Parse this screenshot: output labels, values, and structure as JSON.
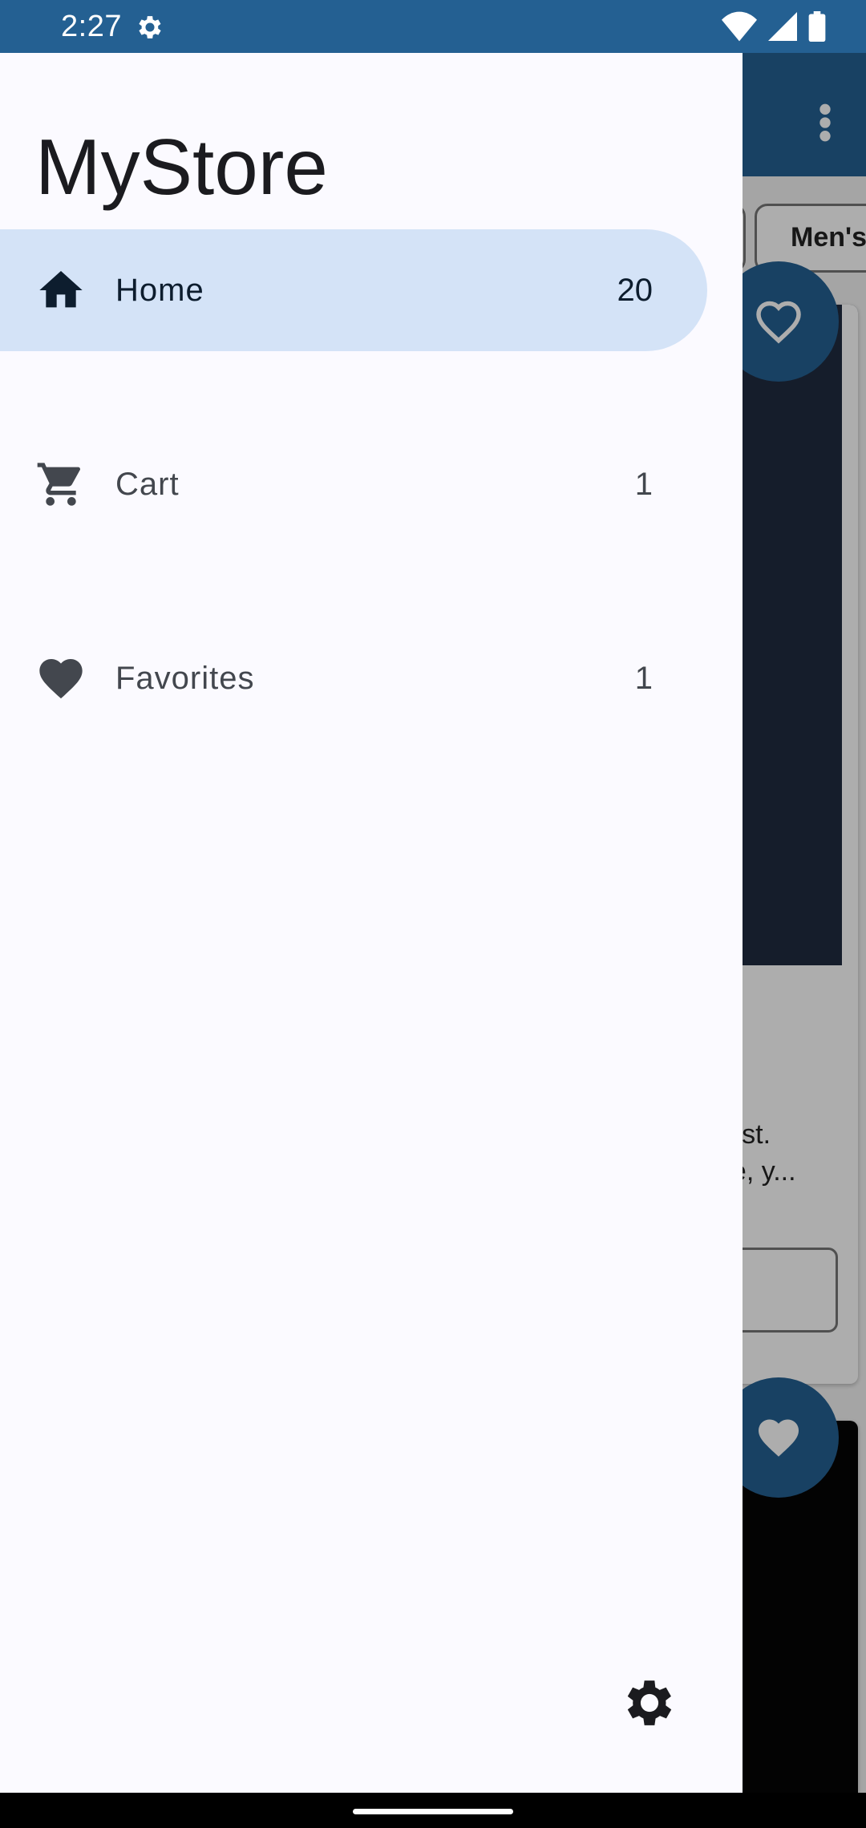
{
  "status_bar": {
    "time": "2:27",
    "icons": [
      "settings-icon",
      "wifi-icon",
      "signal-icon",
      "battery-icon"
    ]
  },
  "background": {
    "chips": [
      "",
      "Men's"
    ],
    "card_description": [
      "orest.",
      "eve, y..."
    ]
  },
  "drawer": {
    "title": "MyStore",
    "items": [
      {
        "label": "Home",
        "count": "20",
        "icon": "home-icon",
        "selected": true
      },
      {
        "label": "Cart",
        "count": "1",
        "icon": "cart-icon",
        "selected": false
      },
      {
        "label": "Favorites",
        "count": "1",
        "icon": "heart-icon",
        "selected": false
      }
    ],
    "settings_icon": "gear-icon"
  },
  "colors": {
    "primary": "#246092",
    "active_item": "#d4e3f7",
    "drawer_bg": "#fbfaff"
  }
}
